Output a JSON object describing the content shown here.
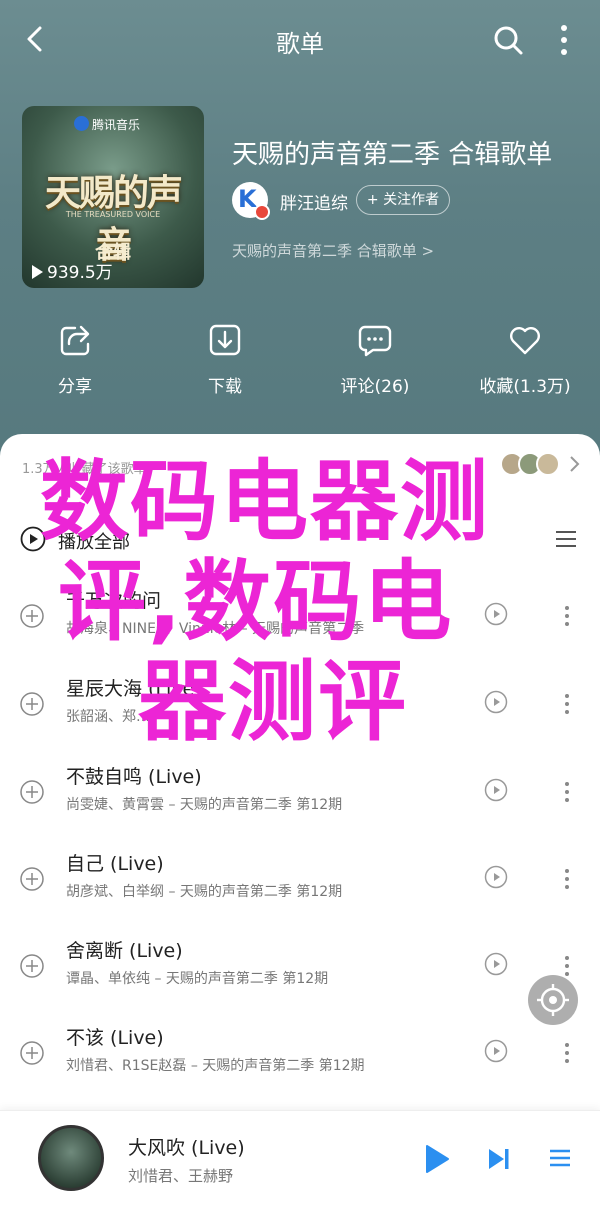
{
  "header": {
    "title": "歌单"
  },
  "cover": {
    "brand": "腾讯音乐",
    "show_title": "天赐的声音",
    "show_subtitle": "THE TREASURED VOICE",
    "album_tag": "合辑",
    "play_count": "939.5万"
  },
  "playlist": {
    "title": "天赐的声音第二季 合辑歌单",
    "creator": "胖汪追综",
    "follow_label": "+ 关注作者",
    "description": "天赐的声音第二季 合辑歌单 >"
  },
  "actions": [
    {
      "label": "分享",
      "icon": "share-icon"
    },
    {
      "label": "下载",
      "icon": "download-icon"
    },
    {
      "label": "评论(26)",
      "icon": "comment-icon"
    },
    {
      "label": "收藏(1.3万)",
      "icon": "heart-icon"
    }
  ],
  "list": {
    "updated": "1.3万人收藏了该歌单",
    "play_all": "播放全部"
  },
  "songs": [
    {
      "name": "千万次的问",
      "meta": "胡海泉、NINE0、Vinnie林 – 天赐的声音第二季"
    },
    {
      "name": "星辰大海 (Live)",
      "meta": "张韶涵、郑…"
    },
    {
      "name": "不鼓自鸣 (Live)",
      "meta": "尚雯婕、黄霄雲 – 天赐的声音第二季 第12期"
    },
    {
      "name": "自己 (Live)",
      "meta": "胡彦斌、白举纲 – 天赐的声音第二季 第12期"
    },
    {
      "name": "舍离断 (Live)",
      "meta": "谭晶、单依纯 – 天赐的声音第二季 第12期"
    },
    {
      "name": "不该 (Live)",
      "meta": "刘惜君、R1SE赵磊 – 天赐的声音第二季 第12期"
    }
  ],
  "player": {
    "title": "大风吹 (Live)",
    "artist": "刘惜君、王赫野"
  },
  "overlay": {
    "line1": "数码电器测",
    "line2": "评,数码电",
    "line3": "器测评"
  },
  "colors": {
    "hero_bg": "#5d7f84",
    "overlay_text": "#ec25d5",
    "accent_blue": "#2a6fd6"
  }
}
